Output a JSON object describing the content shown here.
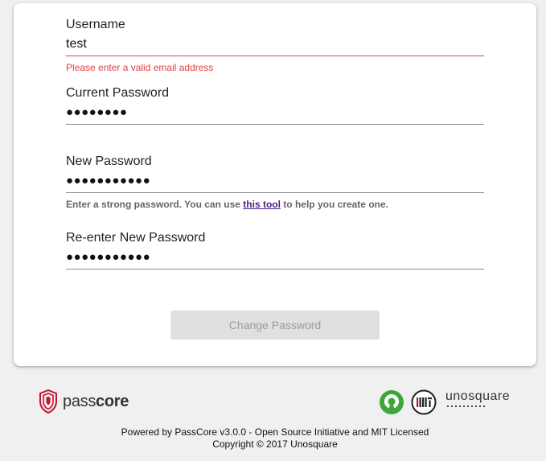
{
  "form": {
    "username": {
      "label": "Username",
      "value": "test",
      "error": "Please enter a valid email address"
    },
    "current_password": {
      "label": "Current Password",
      "value": "●●●●●●●●"
    },
    "new_password": {
      "label": "New Password",
      "value": "●●●●●●●●●●●",
      "helper_before": "Enter a strong password. You can use ",
      "helper_link": "this tool",
      "helper_after": " to help you create one."
    },
    "reenter_password": {
      "label": "Re-enter New Password",
      "value": "●●●●●●●●●●●"
    },
    "submit_label": "Change Password"
  },
  "footer": {
    "passcore_wordmark_light": "pass",
    "passcore_wordmark_bold": "core",
    "unosquare_wordmark": "unosquare",
    "powered_by": "Powered by PassCore v3.0.0 - Open Source Initiative and MIT Licensed",
    "copyright": "Copyright © 2017 Unosquare"
  },
  "colors": {
    "error": "#e04040",
    "link": "#4b1f86",
    "osi_green": "#3da639",
    "passcore_red": "#c8102e"
  }
}
